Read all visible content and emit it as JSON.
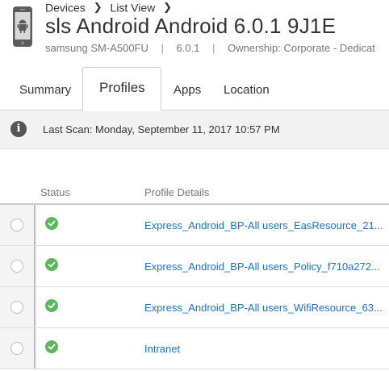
{
  "breadcrumb": {
    "items": [
      "Devices",
      "List View"
    ]
  },
  "device": {
    "title": "sls Android Android 6.0.1 9J1E",
    "model": "samsung SM-A500FU",
    "os_version": "6.0.1",
    "ownership": "Ownership: Corporate - Dedicat",
    "icon": "android-phone-icon"
  },
  "tabs": [
    {
      "label": "Summary",
      "active": false
    },
    {
      "label": "Profiles",
      "active": true
    },
    {
      "label": "Apps",
      "active": false
    },
    {
      "label": "Location",
      "active": false
    }
  ],
  "scan": {
    "text": "Last Scan: Monday, September 11, 2017 10:57 PM",
    "icon": "info-icon"
  },
  "table": {
    "headers": {
      "status": "Status",
      "profile_details": "Profile Details"
    },
    "rows": [
      {
        "status": "installed",
        "profile": "Express_Android_BP-All users_EasResource_21..."
      },
      {
        "status": "installed",
        "profile": "Express_Android_BP-All users_Policy_f710a272..."
      },
      {
        "status": "installed",
        "profile": "Express_Android_BP-All users_WifiResource_63..."
      },
      {
        "status": "installed",
        "profile": "Intranet"
      }
    ]
  },
  "colors": {
    "link": "#1a73c9",
    "status_ok": "#5cb85c",
    "scan_bar": "#f2f2f2"
  }
}
